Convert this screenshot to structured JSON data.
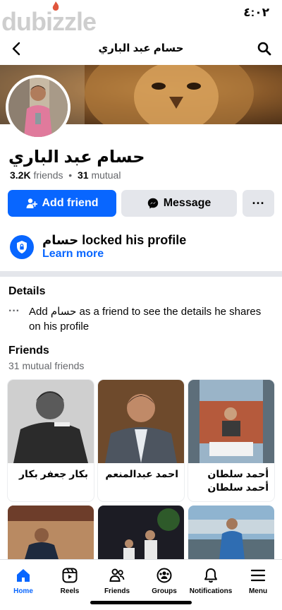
{
  "status_bar": {
    "time": "٤:٠٢"
  },
  "watermark": {
    "text": "dubizzle"
  },
  "nav": {
    "title": "حسام عبد الباري"
  },
  "profile": {
    "name": "حسام عبد الباري",
    "friends_count": "3.2K",
    "friends_word": "friends",
    "separator": "•",
    "mutual_count": "31",
    "mutual_word": "mutual"
  },
  "actions": {
    "add_friend": "Add friend",
    "message": "Message",
    "more": "···"
  },
  "locked": {
    "title": "حسام locked his profile",
    "link": "Learn more"
  },
  "details": {
    "heading": "Details",
    "bullet": "···",
    "text": "Add حسام as a friend to see the details he shares on his profile"
  },
  "friends": {
    "heading": "Friends",
    "subtitle": "31 mutual friends",
    "cards": [
      {
        "name": "بكار جعفر بكار"
      },
      {
        "name": "احمد عبدالمنعم"
      },
      {
        "name": "أحمد سلطان أحمد سلطان"
      }
    ]
  },
  "tabs": [
    {
      "label": "Home",
      "icon": "home-icon",
      "active": true
    },
    {
      "label": "Reels",
      "icon": "reels-icon"
    },
    {
      "label": "Friends",
      "icon": "friends-icon"
    },
    {
      "label": "Groups",
      "icon": "groups-icon"
    },
    {
      "label": "Notifications",
      "icon": "bell-icon"
    },
    {
      "label": "Menu",
      "icon": "menu-icon"
    }
  ],
  "colors": {
    "accent": "#0866ff",
    "button_gray": "#e4e6eb",
    "secondary_text": "#65676b"
  }
}
